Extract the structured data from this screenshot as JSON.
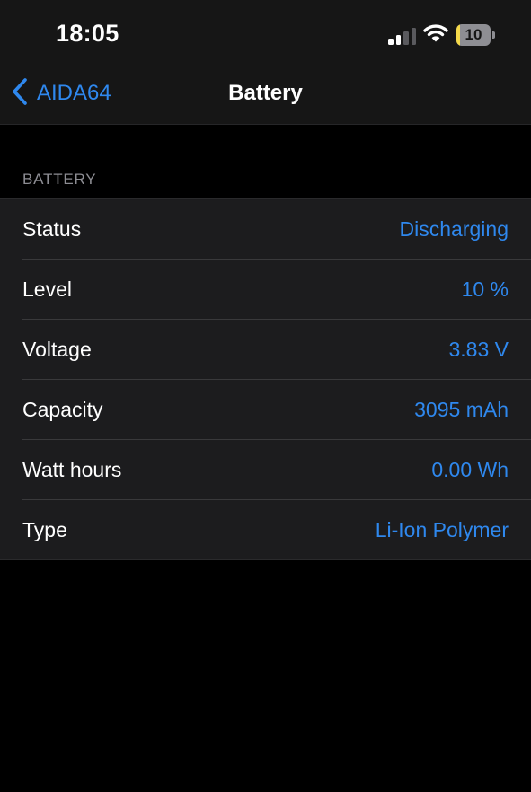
{
  "status_bar": {
    "time": "18:05",
    "battery_level": 10,
    "battery_label": "10",
    "cellular_bars_active": 2,
    "cellular_bars_total": 4
  },
  "nav": {
    "back_label": "AIDA64",
    "title": "Battery"
  },
  "section": {
    "header": "BATTERY",
    "rows": [
      {
        "label": "Status",
        "value": "Discharging"
      },
      {
        "label": "Level",
        "value": "10 %"
      },
      {
        "label": "Voltage",
        "value": "3.83 V"
      },
      {
        "label": "Capacity",
        "value": "3095 mAh"
      },
      {
        "label": "Watt hours",
        "value": "0.00 Wh"
      },
      {
        "label": "Type",
        "value": "Li-Ion Polymer"
      }
    ]
  },
  "colors": {
    "accent": "#2f88ee",
    "background": "#000000",
    "bar_background": "#161616",
    "cell_background": "#1c1c1e",
    "section_header": "#8d8d93",
    "battery_fill": "#f5d94a",
    "signal_inactive": "#5a5a5e"
  },
  "icons": {
    "back": "chevron-left-icon",
    "signal": "cellular-signal-icon",
    "wifi": "wifi-icon",
    "battery": "battery-icon"
  }
}
